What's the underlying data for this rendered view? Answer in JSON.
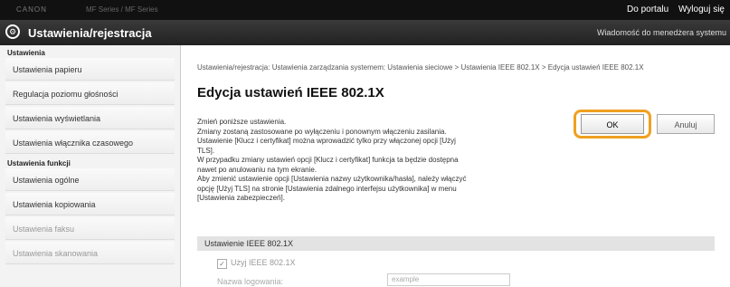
{
  "topbar": {
    "device_name": "CANON",
    "model": "MF Series / MF Series",
    "portal_link": "Do portalu",
    "logout_link": "Wyloguj się"
  },
  "header": {
    "title": "Ustawienia/rejestracja",
    "message_link": "Wiadomość do menedżera systemu"
  },
  "sidebar": {
    "section1": "Ustawienia",
    "items1": [
      "Ustawienia papieru",
      "Regulacja poziomu głośności",
      "Ustawienia wyświetlania",
      "Ustawienia włącznika czasowego"
    ],
    "section2": "Ustawienia funkcji",
    "items2": [
      "Ustawienia ogólne",
      "Ustawienia kopiowania",
      "Ustawienia faksu",
      "Ustawienia skanowania"
    ]
  },
  "main": {
    "breadcrumb": "Ustawienia/rejestracja: Ustawienia zarządzania systemem: Ustawienia sieciowe > Ustawienia IEEE 802.1X > Edycja ustawień IEEE 802.1X",
    "page_title": "Edycja ustawień IEEE 802.1X",
    "description": [
      "Zmień poniższe ustawienia.",
      "Zmiany zostaną zastosowane po wyłączeniu i ponownym włączeniu zasilania.",
      "Ustawienie [Klucz i certyfikat] można wprowadzić tylko przy włączonej opcji [Użyj",
      "TLS].",
      "W przypadku zmiany ustawień opcji [Klucz i certyfikat] funkcja ta będzie dostępna",
      "nawet po anulowaniu na tym ekranie.",
      "Aby zmienić ustawienie opcji [Ustawienia nazwy użytkownika/hasła], należy włączyć",
      "opcję [Użyj TLS] na stronie [Ustawienia zdalnego interfejsu użytkownika] w menu",
      "[Ustawienia zabezpieczeń]."
    ],
    "ok_label": "OK",
    "cancel_label": "Anuluj",
    "section_title": "Ustawienie IEEE 802.1X",
    "checkbox_label": "Użyj IEEE 802.1X",
    "login_label": "Nazwa logowania:",
    "login_value": "example"
  }
}
